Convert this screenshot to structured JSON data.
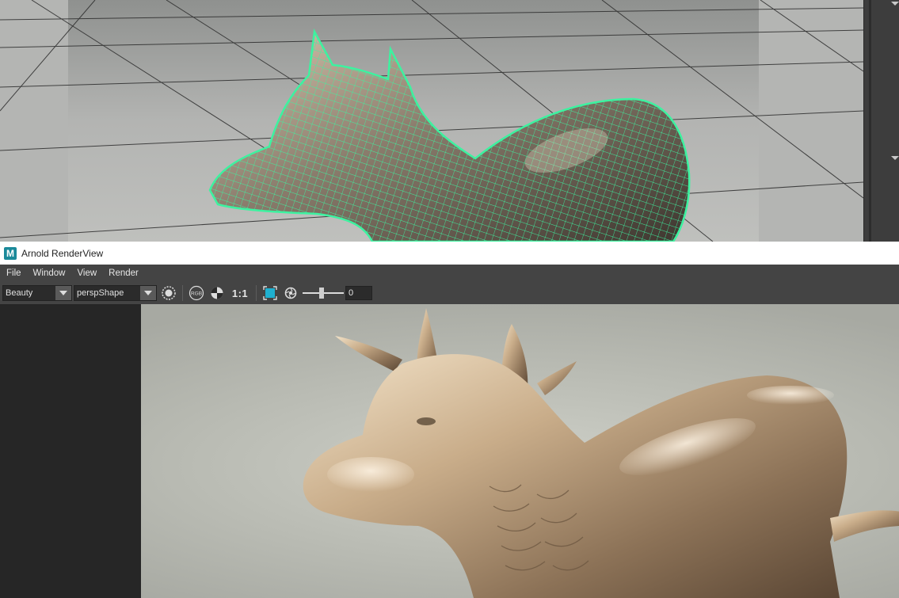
{
  "viewport": {
    "label": "Maya perspective viewport",
    "model_wireframe_color": "#3df2a0",
    "floor_color": "#b8b9b6"
  },
  "renderview": {
    "app_icon": "maya-logo-icon",
    "app_icon_letter": "M",
    "title": "Arnold RenderView",
    "menu": [
      "File",
      "Window",
      "View",
      "Render"
    ],
    "toolbar": {
      "aov": "Beauty",
      "camera": "perspShape",
      "channel_label": "RGB",
      "ratio": "1:1",
      "exposure": "0"
    },
    "render_material_color": "#c9ad8a"
  }
}
